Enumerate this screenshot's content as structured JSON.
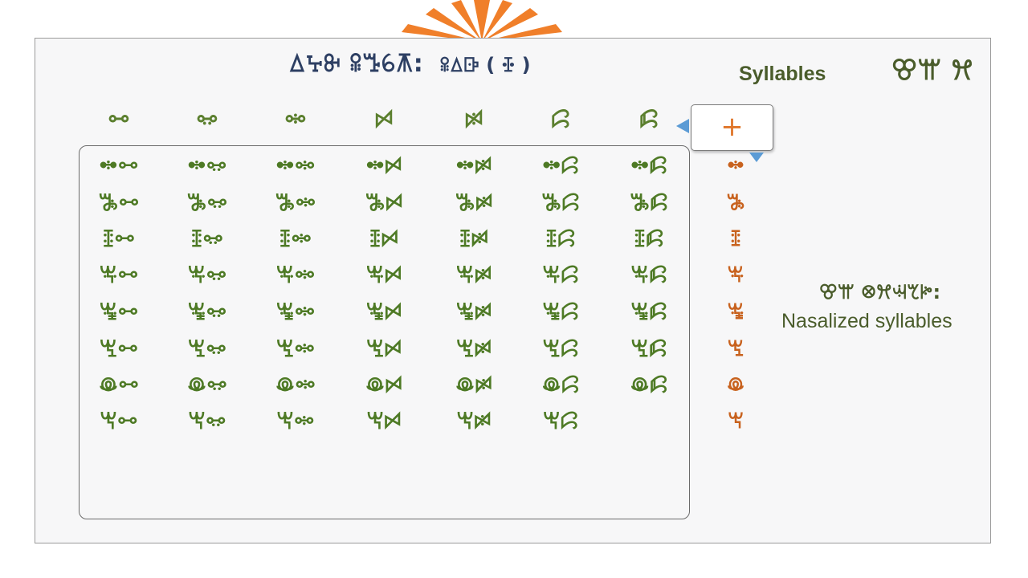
{
  "title": {
    "main": "ꕔꕴꔬ ꕉꔤꕃꕧ:",
    "sub": "ꕉꕔꕒ ( ꔀ )"
  },
  "header": {
    "syllables_label": "Syllables",
    "script_label": "ꕢꕌ ꕮ"
  },
  "nasal": {
    "script_label": "ꕢꕌ ꕕꕮꕜꕎꔶ:",
    "label": "Nasalized syllables"
  },
  "plus_button": {
    "label": "+"
  },
  "colors": {
    "grid_text": "#4e7a25",
    "consonant": "#c8621e",
    "title": "#2d3f63",
    "arrow": "#5b9bd5"
  },
  "vowels": [
    "ꗬ",
    "ꗭ",
    "ꗮ",
    "ꗯ",
    "ꗰ",
    "ꗱ",
    "ꗲ"
  ],
  "consonants": [
    "ꖒ",
    "ꖓ",
    "ꖔ",
    "ꖕ",
    "ꖖ",
    "ꖗ",
    "ꖘ",
    "ꖙ"
  ],
  "grid": [
    [
      "ꖒꗬ",
      "ꖒꗭ",
      "ꖒꗮ",
      "ꖒꗯ",
      "ꖒꗰ",
      "ꖒꗱ",
      "ꖒꗲ"
    ],
    [
      "ꖓꗬ",
      "ꖓꗭ",
      "ꖓꗮ",
      "ꖓꗯ",
      "ꖓꗰ",
      "ꖓꗱ",
      "ꖓꗲ"
    ],
    [
      "ꖔꗬ",
      "ꖔꗭ",
      "ꖔꗮ",
      "ꖔꗯ",
      "ꖔꗰ",
      "ꖔꗱ",
      "ꖔꗲ"
    ],
    [
      "ꖕꗬ",
      "ꖕꗭ",
      "ꖕꗮ",
      "ꖕꗯ",
      "ꖕꗰ",
      "ꖕꗱ",
      "ꖕꗲ"
    ],
    [
      "ꖖꗬ",
      "ꖖꗭ",
      "ꖖꗮ",
      "ꖖꗯ",
      "ꖖꗰ",
      "ꖖꗱ",
      "ꖖꗲ"
    ],
    [
      "ꖗꗬ",
      "ꖗꗭ",
      "ꖗꗮ",
      "ꖗꗯ",
      "ꖗꗰ",
      "ꖗꗱ",
      "ꖗꗲ"
    ],
    [
      "ꖘꗬ",
      "ꖘꗭ",
      "ꖘꗮ",
      "ꖘꗯ",
      "ꖘꗰ",
      "ꖘꗱ",
      "ꖘꗲ"
    ],
    [
      "ꖙꗬ",
      "ꖙꗭ",
      "ꖙꗮ",
      "ꖙꗯ",
      "ꖙꗰ",
      "ꖙꗱ",
      ""
    ]
  ]
}
